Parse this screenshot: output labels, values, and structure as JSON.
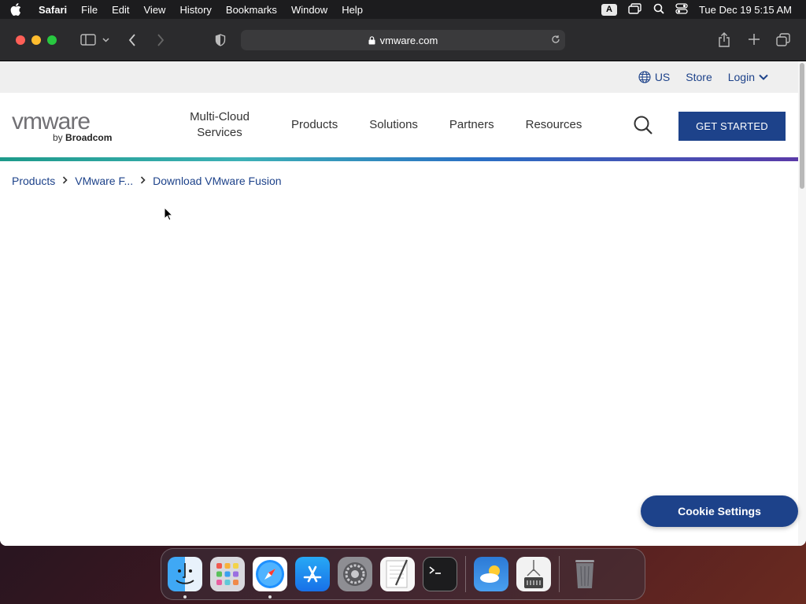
{
  "menubar": {
    "app": "Safari",
    "items": [
      "File",
      "Edit",
      "View",
      "History",
      "Bookmarks",
      "Window",
      "Help"
    ],
    "input_badge": "A",
    "clock": "Tue Dec 19  5:15 AM"
  },
  "browser": {
    "url": "vmware.com"
  },
  "site": {
    "utility": {
      "region": "US",
      "store": "Store",
      "login": "Login"
    },
    "logo": {
      "wordmark": "vmware",
      "by": "by",
      "parent": "Broadcom"
    },
    "nav": {
      "multicloud": "Multi-Cloud Services",
      "products": "Products",
      "solutions": "Solutions",
      "partners": "Partners",
      "resources": "Resources"
    },
    "cta": "GET STARTED",
    "breadcrumb": [
      "Products",
      "VMware F...",
      "Download VMware Fusion"
    ],
    "cookie": "Cookie Settings"
  },
  "colors": {
    "brand_blue": "#1d428a"
  },
  "dock": [
    "finder-icon",
    "launchpad-icon",
    "safari-icon",
    "app-store-icon",
    "system-preferences-icon",
    "textedit-icon",
    "terminal-icon",
    "weather-icon",
    "archive-utility-icon",
    "trash-icon"
  ]
}
